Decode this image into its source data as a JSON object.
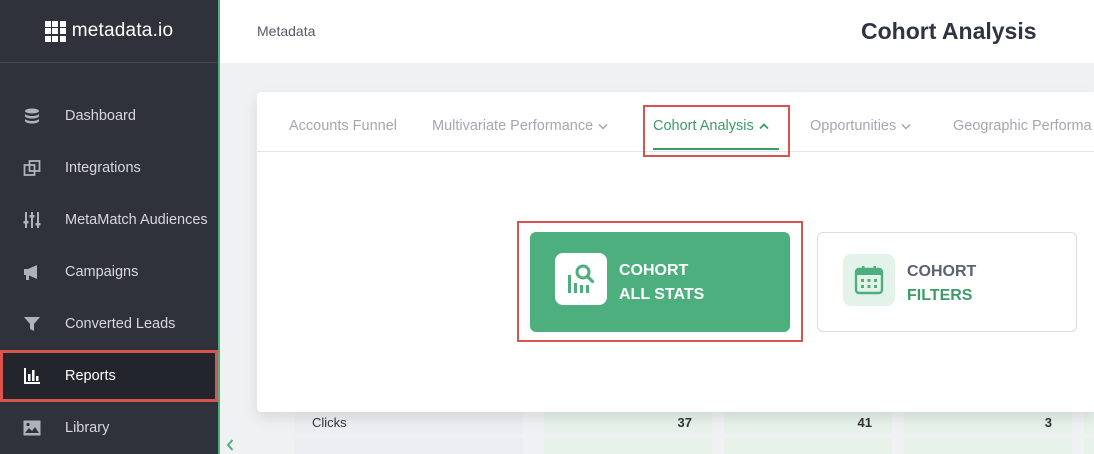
{
  "brand": {
    "name": "metadata.io"
  },
  "sidebar": {
    "items": [
      {
        "label": "Dashboard",
        "icon": "database-icon"
      },
      {
        "label": "Integrations",
        "icon": "integrations-icon"
      },
      {
        "label": "MetaMatch Audiences",
        "icon": "sliders-icon"
      },
      {
        "label": "Campaigns",
        "icon": "megaphone-icon"
      },
      {
        "label": "Converted Leads",
        "icon": "funnel-icon"
      },
      {
        "label": "Reports",
        "icon": "bar-chart-icon",
        "active": true
      },
      {
        "label": "Library",
        "icon": "image-icon"
      }
    ]
  },
  "header": {
    "breadcrumb": "Metadata",
    "title": "Cohort Analysis"
  },
  "tabs": [
    {
      "label": "Accounts Funnel"
    },
    {
      "label": "Multivariate Performance",
      "icon": "chevron-down-icon"
    },
    {
      "label": "Cohort Analysis",
      "icon": "chevron-up-icon",
      "active": true
    },
    {
      "label": "Opportunities",
      "icon": "chevron-down-icon"
    },
    {
      "label": "Geographic Performa"
    }
  ],
  "dropdown": {
    "options": [
      {
        "line1": "COHORT",
        "line2": "ALL STATS",
        "icon": "chart-search-icon"
      },
      {
        "line1": "COHORT",
        "line2": "FILTERS",
        "icon": "calendar-icon"
      }
    ]
  },
  "table": {
    "row_label": "Clicks",
    "values": [
      "37",
      "41",
      "3"
    ]
  },
  "colors": {
    "accent": "#4caf7d",
    "accent_text": "#3c9b67",
    "sidebar": "#30323b",
    "highlight": "#d9534f"
  }
}
